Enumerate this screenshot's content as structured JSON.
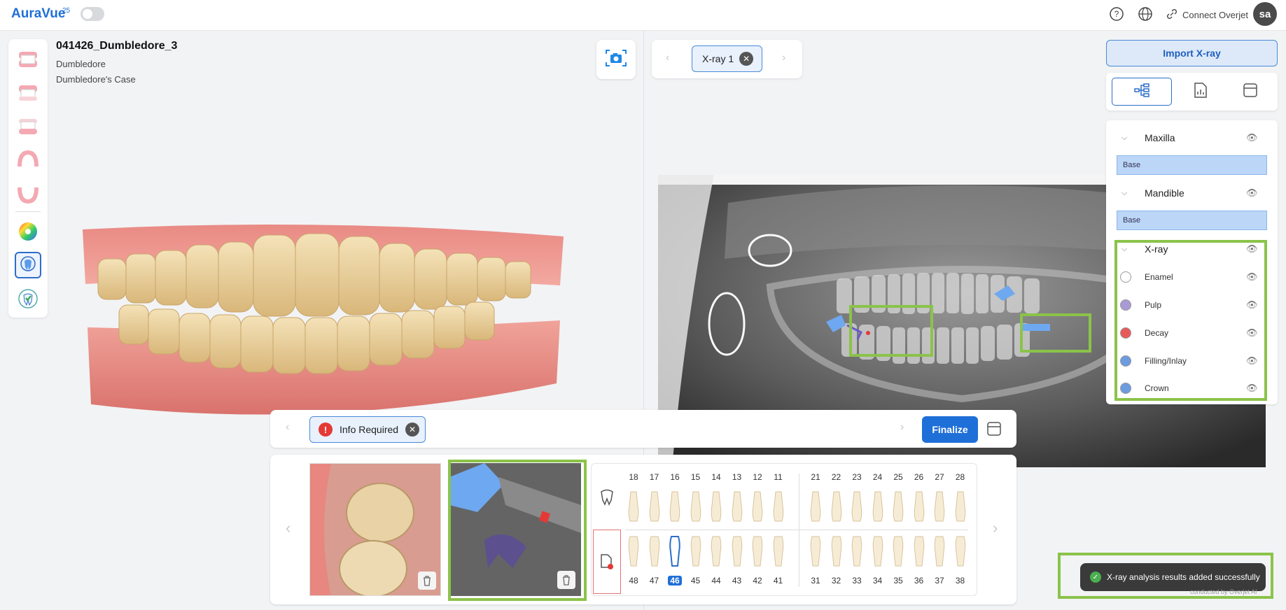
{
  "app": {
    "brand": "AuraVue",
    "brand_sup": "25"
  },
  "header": {
    "connect_label": "Connect Overjet",
    "avatar_initials": "sa"
  },
  "case": {
    "title": "041426_Dumbledore_3",
    "patient": "Dumbledore",
    "case_name": "Dumbledore's Case"
  },
  "xray": {
    "tab_label": "X-ray 1"
  },
  "right_panel": {
    "import_label": "Import X-ray",
    "groups": [
      {
        "name": "Maxilla",
        "base": "Base"
      },
      {
        "name": "Mandible",
        "base": "Base"
      }
    ],
    "xray_group": "X-ray",
    "xray_layers": [
      {
        "name": "Enamel",
        "color": "#ffffff"
      },
      {
        "name": "Pulp",
        "color": "#a99ad6"
      },
      {
        "name": "Decay",
        "color": "#e85a5a"
      },
      {
        "name": "Filling/Inlay",
        "color": "#6c9be0"
      },
      {
        "name": "Crown",
        "color": "#6c9be0"
      }
    ]
  },
  "bottom_bar": {
    "info_required": "Info Required",
    "finalize": "Finalize"
  },
  "tooth_chart": {
    "upper": [
      "18",
      "17",
      "16",
      "15",
      "14",
      "13",
      "12",
      "11",
      "21",
      "22",
      "23",
      "24",
      "25",
      "26",
      "27",
      "28"
    ],
    "lower": [
      "48",
      "47",
      "46",
      "45",
      "44",
      "43",
      "42",
      "41",
      "31",
      "32",
      "33",
      "34",
      "35",
      "36",
      "37",
      "38"
    ],
    "selected": "46"
  },
  "toast": {
    "message": "X-ray analysis results added successfully",
    "powered": "conducted by Overjet AI"
  },
  "colors": {
    "accent": "#1f6fd8",
    "highlight": "#8bc34a"
  }
}
